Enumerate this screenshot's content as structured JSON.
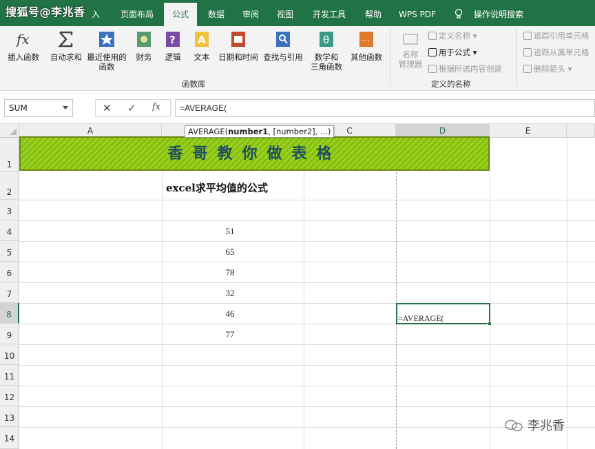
{
  "watermark_top": "搜狐号@李兆香",
  "tabs": [
    {
      "label": "入"
    },
    {
      "label": "页面布局"
    },
    {
      "label": "公式"
    },
    {
      "label": "数据"
    },
    {
      "label": "审阅"
    },
    {
      "label": "视图"
    },
    {
      "label": "开发工具"
    },
    {
      "label": "帮助"
    },
    {
      "label": "WPS PDF"
    },
    {
      "label": "操作说明搜索"
    }
  ],
  "ribbon": {
    "library_buttons": [
      {
        "label": "插入函数",
        "icon": "fx-icon"
      },
      {
        "label": "自动求和",
        "icon": "sigma-icon"
      },
      {
        "label": "最近使用的",
        "label2": "函数",
        "icon": "star-icon"
      },
      {
        "label": "财务",
        "icon": "money-book-icon"
      },
      {
        "label": "逻辑",
        "icon": "question-book-icon"
      },
      {
        "label": "文本",
        "icon": "text-book-icon"
      },
      {
        "label": "日期和时间",
        "icon": "calendar-book-icon"
      },
      {
        "label": "查找与引用",
        "icon": "search-book-icon"
      },
      {
        "label": "数学和",
        "label2": "三角函数",
        "icon": "theta-book-icon"
      },
      {
        "label": "其他函数",
        "icon": "more-book-icon"
      }
    ],
    "library_group": "函数库",
    "name_manager": {
      "label": "名称",
      "label2": "管理器"
    },
    "defined_names": [
      {
        "label": "定义名称"
      },
      {
        "label": "用于公式"
      },
      {
        "label": "根据所选内容创建"
      }
    ],
    "defined_group": "定义的名称",
    "audit": [
      {
        "label": "追踪引用单元格"
      },
      {
        "label": "追踪从属单元格"
      },
      {
        "label": "删除箭头"
      }
    ]
  },
  "formula_bar": {
    "name_box": "SUM",
    "cancel": "✕",
    "enter": "✓",
    "fx": "fx",
    "formula": "=AVERAGE("
  },
  "tooltip": {
    "fn": "AVERAGE(",
    "arg1": "number1",
    "rest": ", [number2], ...)"
  },
  "columns": [
    "A",
    "B",
    "C",
    "D",
    "E"
  ],
  "rows": [
    "1",
    "2",
    "3",
    "4",
    "5",
    "6",
    "7",
    "8",
    "9",
    "10",
    "11",
    "12",
    "13",
    "14"
  ],
  "sheet": {
    "banner": "香哥教你做表格",
    "subtitle": "excel求平均值的公式",
    "values": [
      "51",
      "65",
      "78",
      "32",
      "46",
      "77"
    ],
    "active_cell_text": "=AVERAGE("
  },
  "watermark_bottom": "李兆香",
  "colors": {
    "accent": "#217346",
    "banner": "#9bd21e",
    "banner_text": "#1f4e5f"
  }
}
